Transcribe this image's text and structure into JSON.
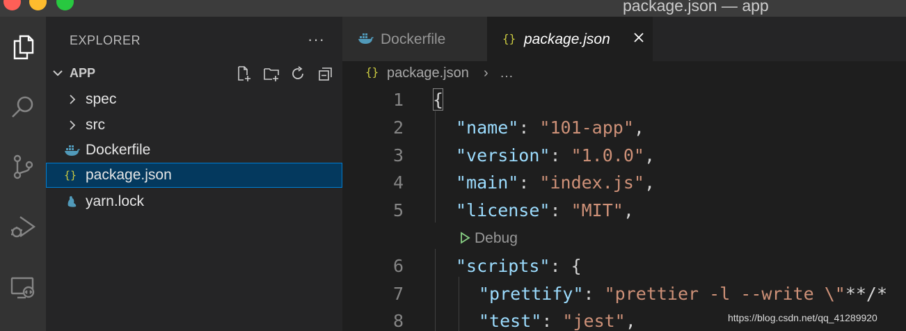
{
  "window": {
    "title": "package.json — app"
  },
  "activity_bar": [
    {
      "name": "explorer-icon"
    },
    {
      "name": "search-icon"
    },
    {
      "name": "source-control-icon"
    },
    {
      "name": "run-debug-icon"
    },
    {
      "name": "remote-explorer-icon"
    }
  ],
  "sidebar": {
    "title": "EXPLORER",
    "more": "···",
    "section": "APP",
    "section_actions": [
      "new-file-icon",
      "new-folder-icon",
      "refresh-icon",
      "collapse-all-icon"
    ],
    "items": [
      {
        "label": "spec",
        "kind": "folder"
      },
      {
        "label": "src",
        "kind": "folder"
      },
      {
        "label": "Dockerfile",
        "kind": "docker-file"
      },
      {
        "label": "package.json",
        "kind": "json-file",
        "icon_text": "{}",
        "selected": true
      },
      {
        "label": "yarn.lock",
        "kind": "yarn-file"
      }
    ]
  },
  "tabs": [
    {
      "label": "Dockerfile",
      "active": false,
      "icon": "docker-icon"
    },
    {
      "label": "package.json",
      "active": true,
      "icon_text": "{}",
      "close": "close-icon"
    }
  ],
  "breadcrumb": {
    "icon_text": "{}",
    "file": "package.json",
    "separator": "›",
    "more": "…"
  },
  "editor": {
    "lines": [
      {
        "n": "1",
        "text": "{"
      },
      {
        "n": "2",
        "text": "\"name\": \"101-app\","
      },
      {
        "n": "3",
        "text": "\"version\": \"1.0.0\","
      },
      {
        "n": "4",
        "text": "\"main\": \"index.js\","
      },
      {
        "n": "5",
        "text": "\"license\": \"MIT\","
      },
      {
        "n": "6",
        "text": "\"scripts\": {"
      },
      {
        "n": "7",
        "text": "\"prettify\": \"prettier -l --write \\\"**/*"
      },
      {
        "n": "8",
        "text": "\"test\": \"jest\","
      }
    ],
    "codelens": "Debug"
  },
  "colors": {
    "key": "#9cdcfe",
    "string": "#ce9178",
    "json_icon": "#cbcb41",
    "docker_icon": "#519aba",
    "selection": "#04395e"
  },
  "watermark": "https://blog.csdn.net/qq_41289920"
}
